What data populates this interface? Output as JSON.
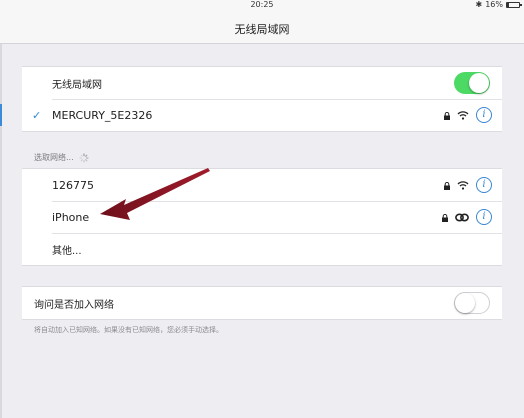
{
  "status_bar": {
    "time": "20:25",
    "battery": "16%",
    "battery_level": 0.16
  },
  "nav": {
    "title": "无线局域网"
  },
  "wifi_section": {
    "toggle_label": "无线局域网",
    "toggle_on": true,
    "connected_network": "MERCURY_5E2326"
  },
  "choose_section": {
    "header": "选取网络...",
    "networks": [
      {
        "name": "126775",
        "icon": "wifi-icon"
      },
      {
        "name": "iPhone",
        "icon": "link-icon"
      }
    ],
    "other": "其他..."
  },
  "ask_section": {
    "label": "询问是否加入网络",
    "toggle_on": false,
    "footer": "将自动加入已知网络。如果没有已知网络，您必须手动选择。"
  },
  "colors": {
    "accent": "#3a86d4",
    "toggle_on": "#4cd964",
    "arrow": "#7a1420"
  }
}
